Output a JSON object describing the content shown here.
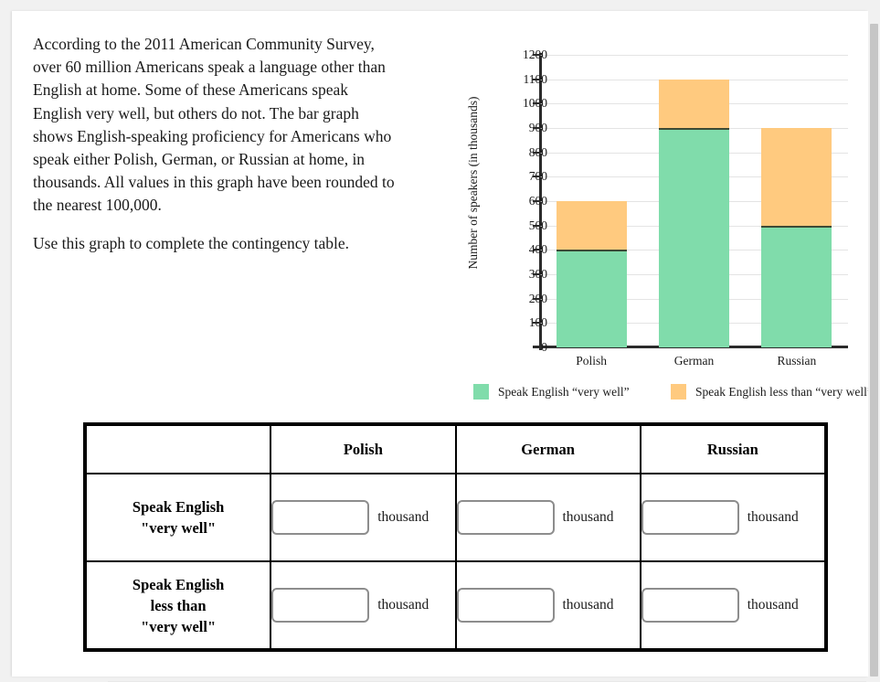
{
  "prompt": {
    "paragraph1": "According to the 2011 American Community Survey, over 60 million Americans speak a language other than English at home. Some of these Americans speak English very well, but others do not. The bar graph shows English-speaking proficiency for Americans who speak either Polish, German, or Russian at home, in thousands. All values in this graph have been rounded to the nearest 100,000.",
    "paragraph2": "Use this graph to complete the contingency table."
  },
  "chart_data": {
    "type": "bar",
    "subtype": "stacked",
    "title": "",
    "xlabel": "",
    "ylabel": "Number of speakers (in thousands)",
    "categories": [
      "Polish",
      "German",
      "Russian"
    ],
    "series": [
      {
        "name": "Speak English “very well”",
        "color": "#80dcab",
        "values": [
          400,
          900,
          500
        ]
      },
      {
        "name": "Speak English less than “very well”",
        "color": "#ffca7f",
        "values": [
          200,
          200,
          400
        ]
      }
    ],
    "totals": [
      600,
      1100,
      900
    ],
    "ylim": [
      0,
      1200
    ],
    "ytick_step": 100,
    "ytick_labels": [
      "0",
      "100",
      "200",
      "300",
      "400",
      "500",
      "600",
      "700",
      "800",
      "900",
      "1000",
      "1100",
      "1200"
    ],
    "grid": true,
    "legend_position": "bottom"
  },
  "legend": {
    "items": [
      {
        "label": "Speak English “very well”",
        "color": "#80dcab"
      },
      {
        "label": "Speak English less than “very well”",
        "color": "#ffca7f"
      }
    ]
  },
  "table": {
    "corner_label": "",
    "column_headers": [
      "Polish",
      "German",
      "Russian"
    ],
    "unit": "thousand",
    "rows": [
      {
        "header_lines": [
          "Speak English",
          "\"very well\""
        ],
        "cells": [
          {
            "value": "",
            "placeholder": ""
          },
          {
            "value": "",
            "placeholder": ""
          },
          {
            "value": "",
            "placeholder": ""
          }
        ]
      },
      {
        "header_lines": [
          "Speak English",
          "less than",
          "\"very well\""
        ],
        "cells": [
          {
            "value": "",
            "placeholder": ""
          },
          {
            "value": "",
            "placeholder": ""
          },
          {
            "value": "",
            "placeholder": ""
          }
        ]
      }
    ]
  },
  "colors": {
    "green": "#80dcab",
    "orange": "#ffca7f",
    "page_background": "#f1f1f1",
    "card_background": "#ffffff",
    "axis": "#2b2b2b",
    "gridline": "#e4e4e4"
  }
}
